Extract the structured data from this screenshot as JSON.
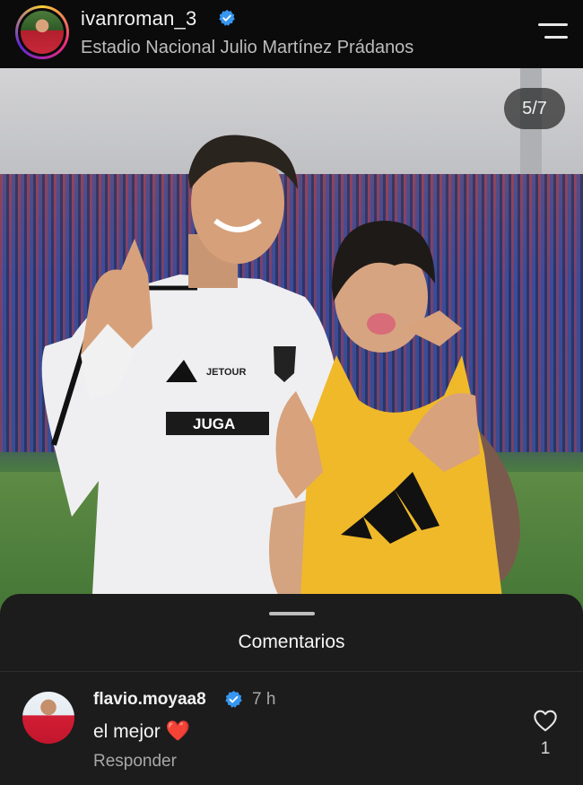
{
  "header": {
    "username": "ivanroman_3",
    "location": "Estadio Nacional Julio Martínez Prádanos",
    "verified_icon": "verified-badge-icon",
    "menu_icon": "hamburger-menu-icon"
  },
  "photo": {
    "counter": "5/7",
    "jersey_text_1": "JETOUR",
    "jersey_text_2": "JUGA"
  },
  "comments": {
    "title": "Comentarios",
    "items": [
      {
        "username": "flavio.moyaa8",
        "time": "7 h",
        "text": "el mejor",
        "emoji": "❤️",
        "reply_label": "Responder",
        "likes": "1"
      }
    ]
  },
  "colors": {
    "verified_blue": "#3797f0",
    "sheet_bg": "#1c1c1c",
    "heart_red": "#e0245e"
  }
}
